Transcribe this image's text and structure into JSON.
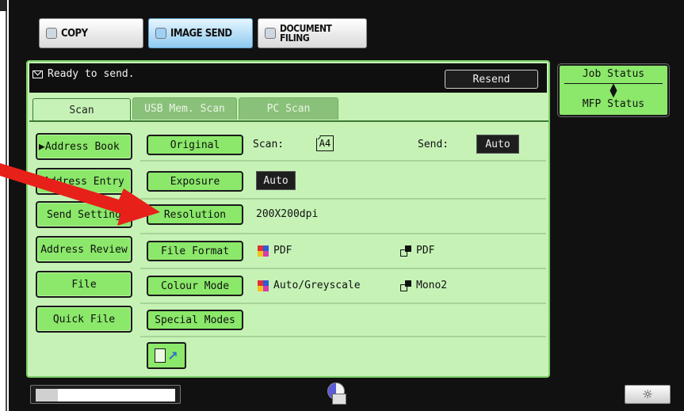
{
  "mode_tabs": [
    {
      "label": "COPY",
      "active": false
    },
    {
      "label": "IMAGE SEND",
      "active": true
    },
    {
      "label_line1": "DOCUMENT",
      "label_line2": "FILING",
      "active": false
    }
  ],
  "status": {
    "message": "Ready to send.",
    "resend_label": "Resend"
  },
  "sub_tabs": [
    {
      "label": "Scan",
      "active": true
    },
    {
      "label": "USB Mem. Scan",
      "active": false
    },
    {
      "label": "PC Scan",
      "active": false
    }
  ],
  "left_menu": [
    {
      "label": "▶Address Book"
    },
    {
      "label": "Address Entry"
    },
    {
      "label": "Send Setting"
    },
    {
      "label": "Address Review"
    },
    {
      "label": "File"
    },
    {
      "label": "Quick File"
    }
  ],
  "settings": {
    "original": {
      "button": "Original",
      "scan_label": "Scan:",
      "scan_value": "A4",
      "send_label": "Send:",
      "send_value": "Auto"
    },
    "exposure": {
      "button": "Exposure",
      "value": "Auto"
    },
    "resolution": {
      "button": "Resolution",
      "value": "200X200dpi"
    },
    "file_format": {
      "button": "File Format",
      "color_value": "PDF",
      "mono_value": "PDF"
    },
    "colour_mode": {
      "button": "Colour Mode",
      "color_value": "Auto/Greyscale",
      "mono_value": "Mono2"
    },
    "special_modes": {
      "button": "Special Modes"
    }
  },
  "right_panel": {
    "job_status": "Job Status",
    "mfp_status": "MFP Status"
  },
  "progress": {
    "fill_fraction": 0.16
  },
  "colors": {
    "accent_green": "#8be86a",
    "panel_green": "#c6f2b6",
    "annotation_red": "#e8201a"
  }
}
